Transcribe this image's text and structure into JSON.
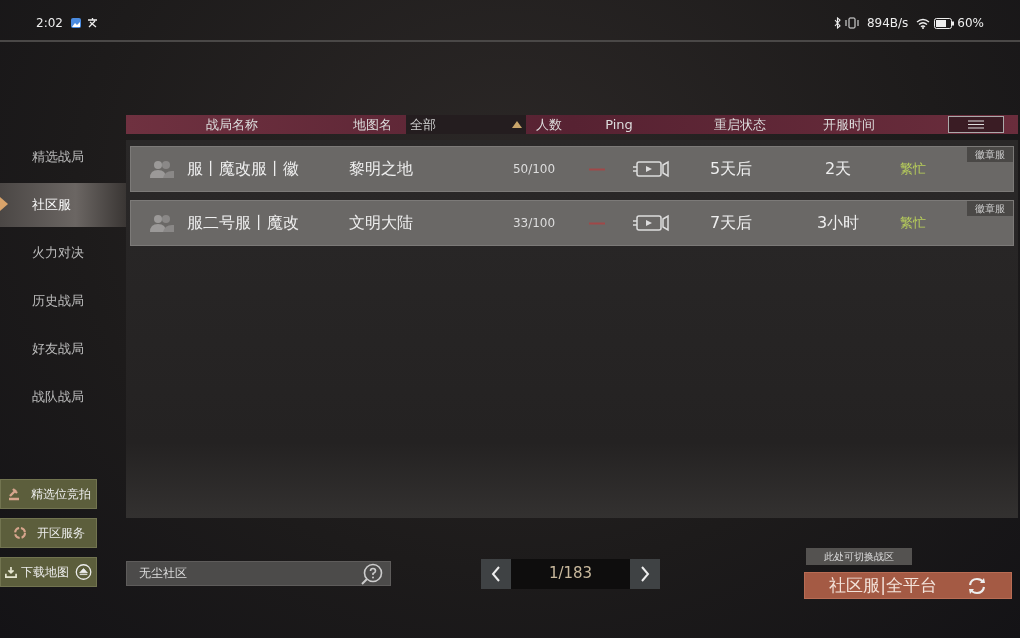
{
  "status_bar": {
    "time": "2:02",
    "speed": "894B/s",
    "battery": "60%"
  },
  "sidebar": {
    "items": [
      {
        "label": "精选战局",
        "selected": false
      },
      {
        "label": "社区服",
        "selected": true
      },
      {
        "label": "火力对决",
        "selected": false
      },
      {
        "label": "历史战局",
        "selected": false
      },
      {
        "label": "好友战局",
        "selected": false
      },
      {
        "label": "战队战局",
        "selected": false
      }
    ]
  },
  "table": {
    "columns": [
      "战局名称",
      "地图名",
      "人数",
      "Ping",
      "重启状态",
      "开服时间"
    ],
    "map_filter": {
      "value": "全部"
    },
    "rows": [
      {
        "name": "服丨魔改服丨徽",
        "map": "黎明之地",
        "players": "50/100",
        "restart": "5天后",
        "uptime": "2天",
        "status": "繁忙",
        "tag": "徽章服"
      },
      {
        "name": "服二号服丨魔改",
        "map": "文明大陆",
        "players": "33/100",
        "restart": "7天后",
        "uptime": "3小时",
        "status": "繁忙",
        "tag": "徽章服"
      }
    ]
  },
  "side_buttons": [
    {
      "kind": "auction",
      "label": "精选位竞拍"
    },
    {
      "kind": "service",
      "label": "开区服务"
    },
    {
      "kind": "download",
      "label": "下载地图"
    }
  ],
  "search": {
    "value": "无尘社区"
  },
  "pager": {
    "page": "1/183"
  },
  "platform": {
    "tooltip": "此处可切换战区",
    "label": "社区服|全平台"
  }
}
